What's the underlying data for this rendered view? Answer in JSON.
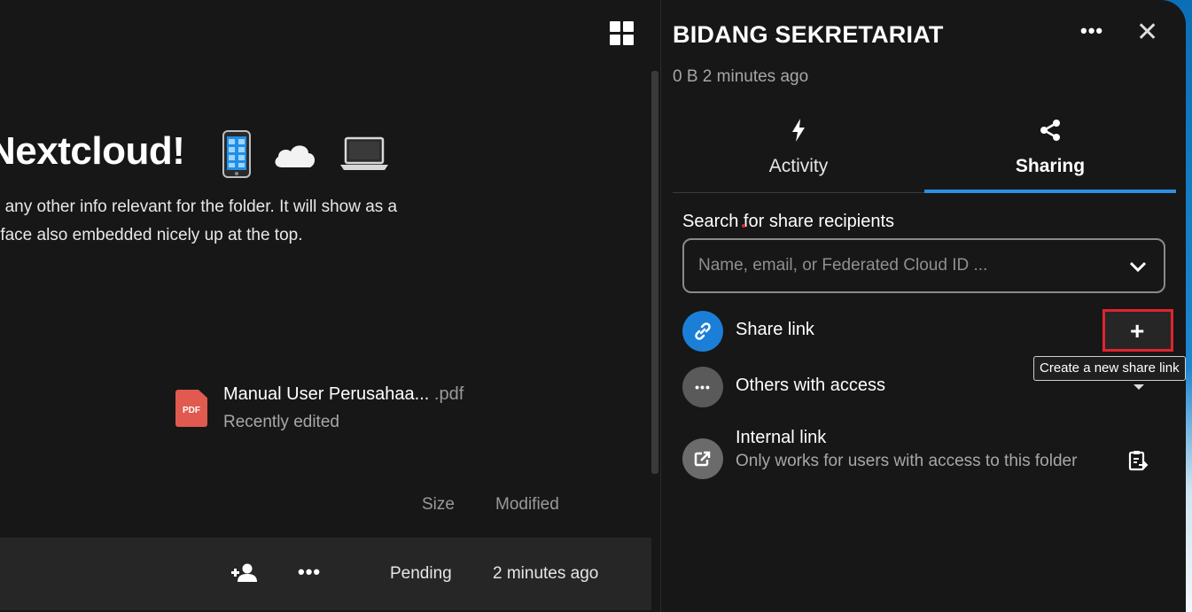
{
  "main": {
    "welcome_title": "Nextcloud!",
    "emojis": [
      "phone-icon",
      "cloud-icon",
      "laptop-icon"
    ],
    "description_line1": "r any other info relevant for the folder. It will show as a",
    "description_line2": "rface also embedded nicely up at the top.",
    "recent_file": {
      "name": "Manual User Perusahaa...",
      "ext": " .pdf",
      "icon_text": "PDF",
      "subtitle": "Recently edited"
    },
    "columns": {
      "size": "Size",
      "modified": "Modified"
    },
    "row": {
      "menu": "•••",
      "status": "Pending",
      "modified": "2 minutes ago"
    }
  },
  "sidebar": {
    "title": "BIDANG SEKRETARIAT",
    "menu": "•••",
    "close": "✕",
    "meta": "0 B 2 minutes ago",
    "tabs": [
      {
        "label": "Activity",
        "icon": "flash-icon",
        "active": false
      },
      {
        "label": "Sharing",
        "icon": "share-icon",
        "active": true
      }
    ],
    "search": {
      "label": "Search for share recipients",
      "placeholder": "Name, email, or Federated Cloud ID ..."
    },
    "share_link": {
      "label": "Share link",
      "add_symbol": "+",
      "tooltip": "Create a new share link"
    },
    "others_with_access": {
      "label": "Others with access",
      "avatar_text": "•••"
    },
    "internal_link": {
      "title": "Internal link",
      "subtitle": "Only works for users with access to this folder"
    }
  },
  "colors": {
    "accent": "#2d8fe0",
    "highlight_border": "#e0242e",
    "background": "#171717",
    "row_background": "#262626"
  }
}
